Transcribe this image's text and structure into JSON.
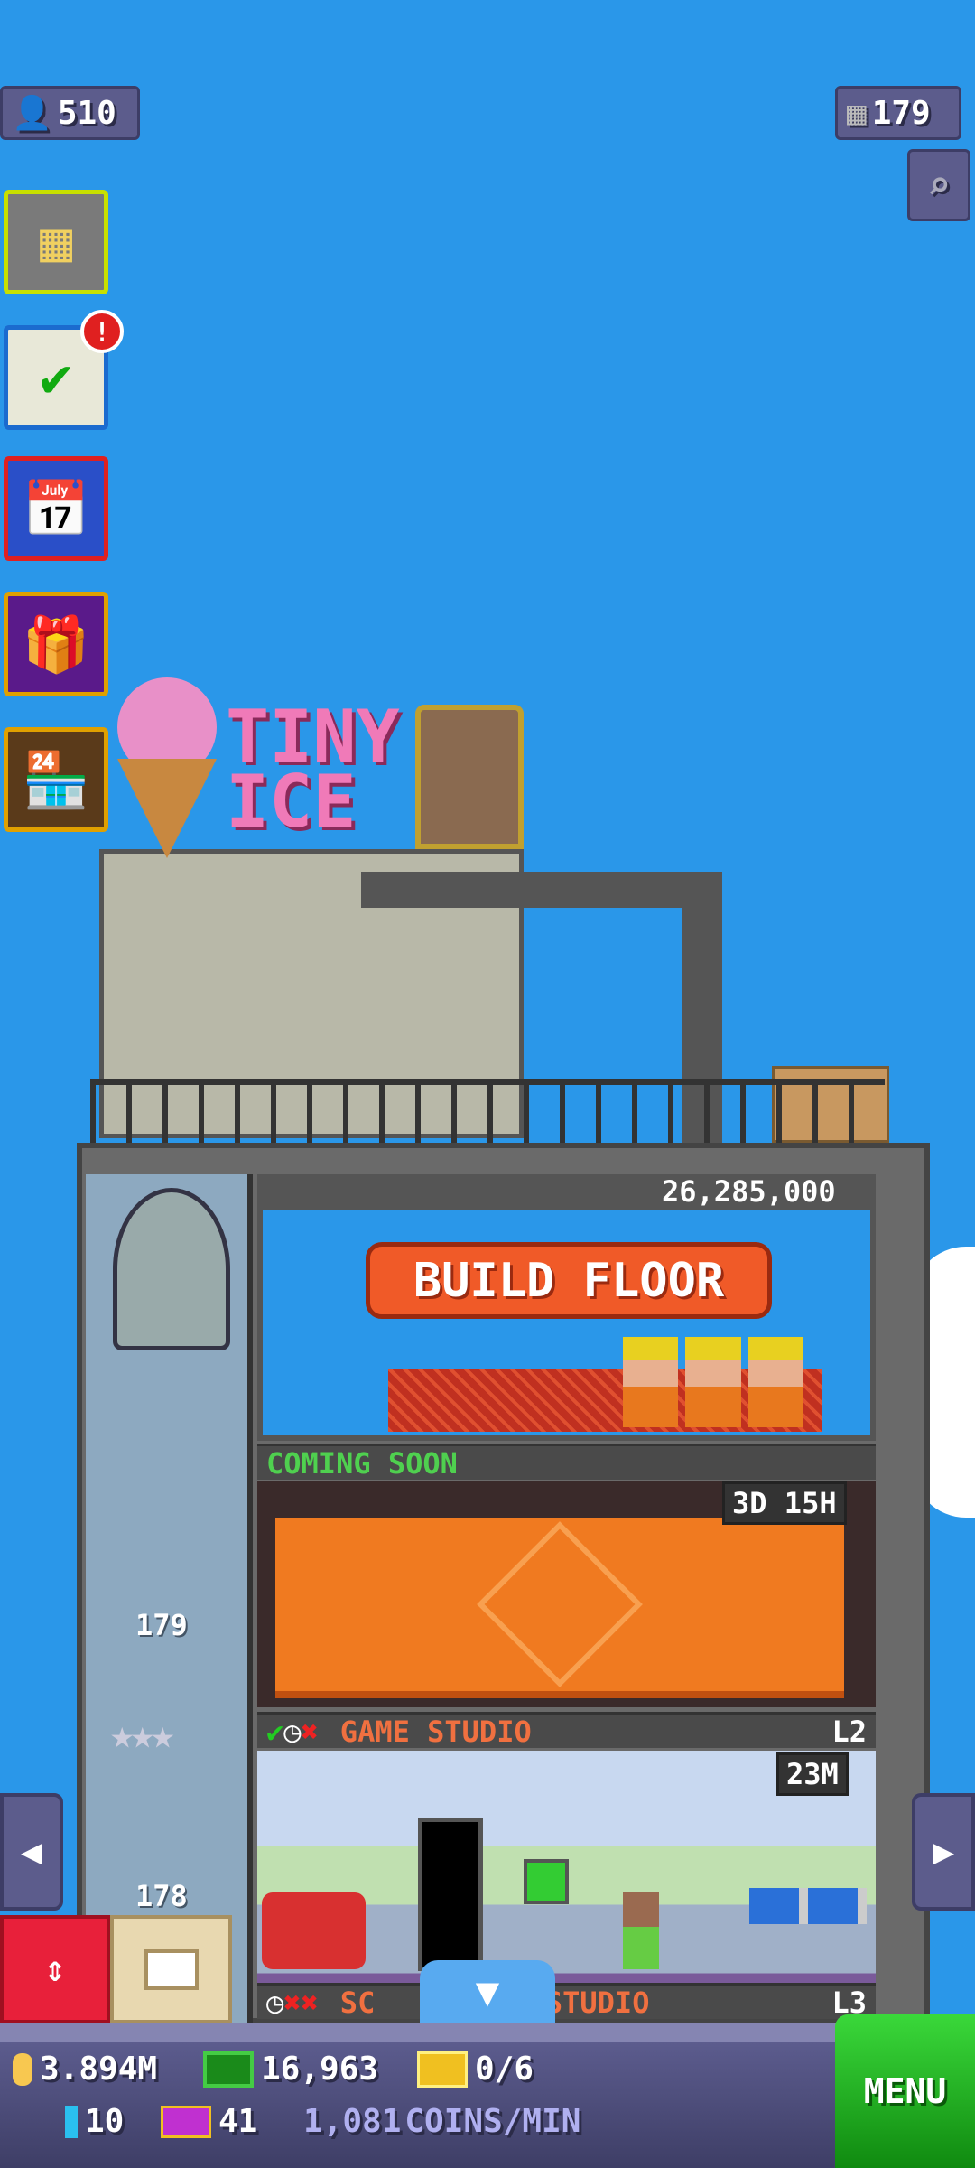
{
  "top": {
    "population": "510",
    "floors": "179"
  },
  "sidebar": {
    "task_alert": "!"
  },
  "rooftop": {
    "sign_line1": "TINY",
    "sign_line2": "ICE"
  },
  "build": {
    "price": "26,285,000",
    "button": "BUILD FLOOR"
  },
  "floors": [
    {
      "label": "COMING SOON",
      "timer": "3D 15H",
      "level": ""
    },
    {
      "label": "GAME STUDIO",
      "timer": "23M",
      "level": "L2"
    },
    {
      "label_start": "SC",
      "label_end": "G STUDIO",
      "level": "L3"
    }
  ],
  "elevator": {
    "floor_upper": "179",
    "floor_lower": "178"
  },
  "stats": {
    "coins": "3.894M",
    "bux": "16,963",
    "golden_tickets": "0/6",
    "vip_cards": "10",
    "legendary_bux": "41",
    "rate": "1,081",
    "rate_unit": "COINS/MIN"
  },
  "menu": {
    "label": "MENU"
  },
  "colors": {
    "sky": "#2a97e9",
    "menu": "#1fa51f",
    "label_orange": "#f07040",
    "coming_soon": "#4fd04f",
    "build_button": "#f05a28"
  }
}
